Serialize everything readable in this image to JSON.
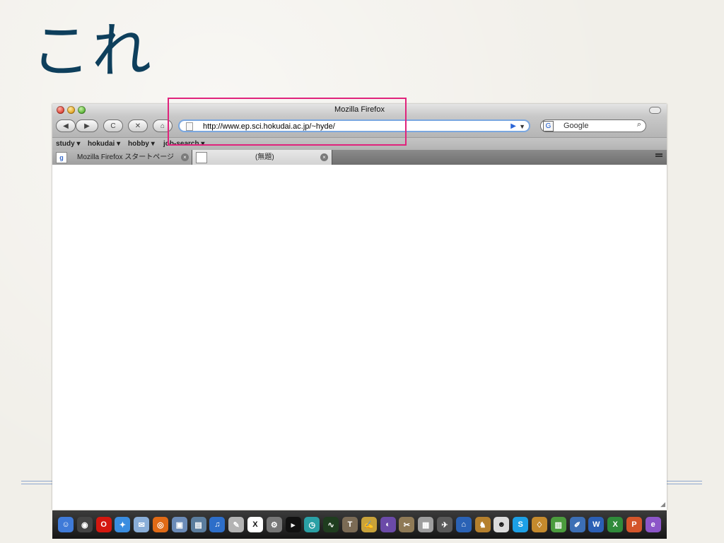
{
  "slide": {
    "title": "これ"
  },
  "window": {
    "title": "Mozilla Firefox"
  },
  "navbar": {
    "back_label": "◀",
    "forward_label": "▶",
    "reload_label": "C",
    "stop_label": "✕",
    "home_label": "⌂",
    "url": "http://www.ep.sci.hokudai.ac.jp/~hyde/",
    "search_engine": "G",
    "search_placeholder": "Google"
  },
  "bookmarks": [
    "study ▾",
    "hokudai ▾",
    "hobby ▾",
    "job-search ▾"
  ],
  "tabs": [
    {
      "label": "Mozilla Firefox スタートページ",
      "favicon": "g"
    },
    {
      "label": "(無題)"
    }
  ],
  "dock": {
    "icons": [
      {
        "name": "finder-icon",
        "color": "#3f7ad8",
        "glyph": "☺"
      },
      {
        "name": "dashboard-icon",
        "color": "#444444",
        "glyph": "◉"
      },
      {
        "name": "opera-icon",
        "color": "#d4170f",
        "glyph": "O"
      },
      {
        "name": "safari-icon",
        "color": "#3a8de0",
        "glyph": "✦"
      },
      {
        "name": "mail-icon",
        "color": "#8aaed8",
        "glyph": "✉"
      },
      {
        "name": "firefox-icon",
        "color": "#e06a16",
        "glyph": "◎"
      },
      {
        "name": "iphoto-icon",
        "color": "#6b8bb8",
        "glyph": "▣"
      },
      {
        "name": "preview-icon",
        "color": "#5b7d9e",
        "glyph": "▤"
      },
      {
        "name": "itunes-icon",
        "color": "#2d6ec9",
        "glyph": "♫"
      },
      {
        "name": "script-editor-icon",
        "color": "#b3b3b3",
        "glyph": "✎"
      },
      {
        "name": "x11-icon",
        "color": "#ffffff",
        "glyph": "X"
      },
      {
        "name": "system-preferences-icon",
        "color": "#777777",
        "glyph": "⚙"
      },
      {
        "name": "terminal-icon",
        "color": "#111111",
        "glyph": "▸"
      },
      {
        "name": "time-machine-icon",
        "color": "#2aa0a5",
        "glyph": "◷"
      },
      {
        "name": "activity-monitor-icon",
        "color": "#1f3d1f",
        "glyph": "∿"
      },
      {
        "name": "latex-icon",
        "color": "#7b6b55",
        "glyph": "T"
      },
      {
        "name": "texshop-icon",
        "color": "#c8a23a",
        "glyph": "✍"
      },
      {
        "name": "eclipse-icon",
        "color": "#6b4aa8",
        "glyph": "◐"
      },
      {
        "name": "gimp-icon",
        "color": "#8f7a56",
        "glyph": "✂"
      },
      {
        "name": "utility-icon",
        "color": "#9e9e9e",
        "glyph": "▦"
      },
      {
        "name": "cyberduck-icon",
        "color": "#5a5a5a",
        "glyph": "✈"
      },
      {
        "name": "home-icon",
        "color": "#2a62b5",
        "glyph": "⌂"
      },
      {
        "name": "adium-icon",
        "color": "#b5802d",
        "glyph": "♞"
      },
      {
        "name": "ichat-icon",
        "color": "#dcdcdc",
        "glyph": "☻"
      },
      {
        "name": "skype-icon",
        "color": "#1da0e6",
        "glyph": "S"
      },
      {
        "name": "keynote-icon",
        "color": "#c48a2d",
        "glyph": "♢"
      },
      {
        "name": "numbers-icon",
        "color": "#4b9c3d",
        "glyph": "▥"
      },
      {
        "name": "pages-icon",
        "color": "#3c6fb5",
        "glyph": "✐"
      },
      {
        "name": "word-icon",
        "color": "#2b5fb5",
        "glyph": "W"
      },
      {
        "name": "excel-icon",
        "color": "#2f8b3a",
        "glyph": "X"
      },
      {
        "name": "powerpoint-icon",
        "color": "#d4552a",
        "glyph": "P"
      },
      {
        "name": "entourage-icon",
        "color": "#8c55c8",
        "glyph": "e"
      }
    ]
  }
}
